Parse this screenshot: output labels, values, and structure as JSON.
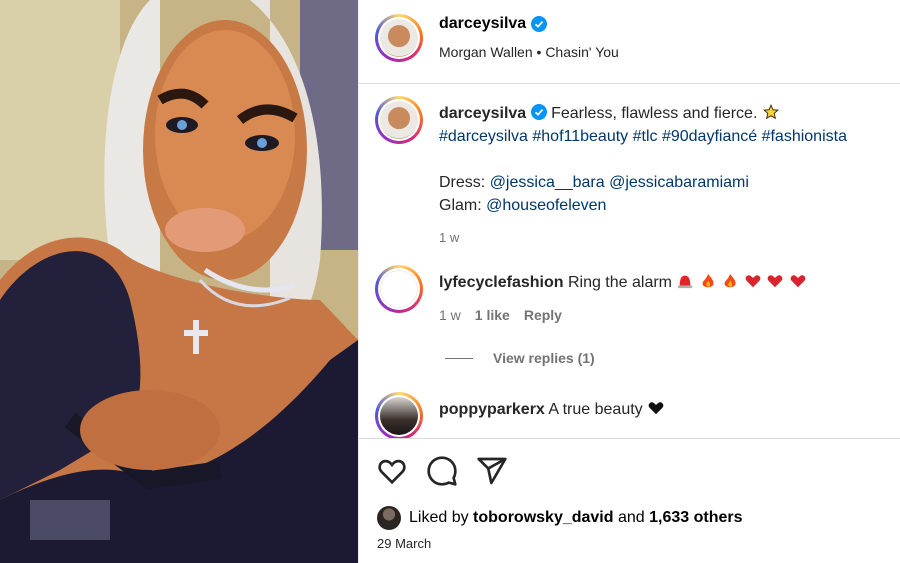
{
  "post": {
    "username": "darceysilva",
    "music": "Morgan Wallen • Chasin' You"
  },
  "caption": {
    "username": "darceysilva",
    "text": "Fearless, flawless and fierce.",
    "hashtags": "#darceysilva #hof11beauty #tlc #90dayfiancé #fashionista",
    "dress_label": "Dress:",
    "dress_tags": "@jessica__bara @jessicabaramiami",
    "glam_label": "Glam:",
    "glam_tag": "@houseofeleven",
    "time": "1 w",
    "icons": [
      "star-emoji"
    ]
  },
  "comments": [
    {
      "username": "lyfecyclefashion",
      "text": "Ring the alarm",
      "time": "1 w",
      "likes": "1 like",
      "reply_label": "Reply",
      "view_replies": "View replies (1)",
      "icons": [
        "siren-emoji",
        "fire-emoji",
        "fire-emoji",
        "heart-emoji",
        "heart-emoji",
        "heart-emoji"
      ]
    },
    {
      "username": "poppyparkerx",
      "text": "A true beauty",
      "icons": [
        "black-heart-emoji"
      ]
    }
  ],
  "actions": {
    "icons": [
      "heart-icon",
      "comment-icon",
      "share-icon"
    ],
    "liked_by_prefix": "Liked by",
    "liked_by_user": "toborowsky_david",
    "liked_by_and": "and",
    "liked_by_count": "1,633 others",
    "date": "29 March"
  },
  "colors": {
    "verified": "#0095f6",
    "link": "#00376b",
    "secondary_text": "#737373",
    "divider": "#dbdbdb"
  }
}
